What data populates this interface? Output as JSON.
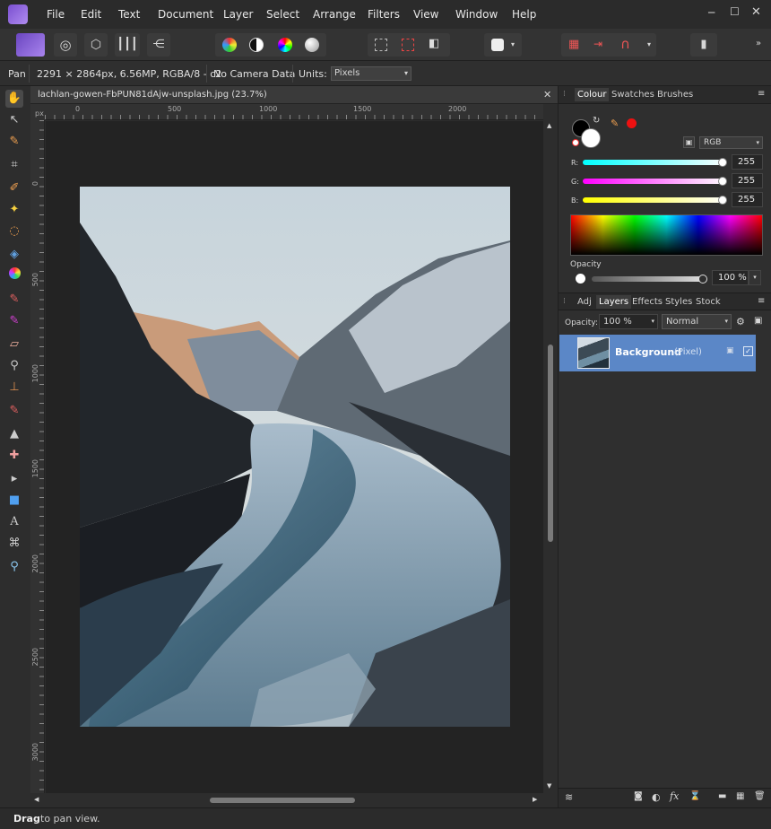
{
  "menu": [
    "File",
    "Edit",
    "Text",
    "Document",
    "Layer",
    "Select",
    "Arrange",
    "Filters",
    "View",
    "Window",
    "Help"
  ],
  "context": {
    "tool": "Pan",
    "info": "2291 × 2864px, 6.56MP, RGBA/8 - c2",
    "camera": "No Camera Data",
    "units_label": "Units:",
    "units_value": "Pixels"
  },
  "document": {
    "tab_title": "lachlan-gowen-FbPUN81dAjw-unsplash.jpg (23.7%)"
  },
  "rulers": {
    "top_unit": "px",
    "top": [
      "0",
      "500",
      "1000",
      "1500",
      "2000"
    ],
    "left": [
      "0",
      "500",
      "1000",
      "1500",
      "2000",
      "2500",
      "3000"
    ]
  },
  "colour_panel": {
    "tabs": [
      "Colour",
      "Swatches",
      "Brushes"
    ],
    "model": "RGB",
    "channels": [
      {
        "label": "R:",
        "value": "255"
      },
      {
        "label": "G:",
        "value": "255"
      },
      {
        "label": "B:",
        "value": "255"
      }
    ],
    "opacity_label": "Opacity",
    "opacity_value": "100 %"
  },
  "layers_panel": {
    "tabs": [
      "Adj",
      "Layers",
      "Effects",
      "Styles",
      "Stock"
    ],
    "opacity_label": "Opacity:",
    "opacity_value": "100 %",
    "blend_mode": "Normal",
    "layers": [
      {
        "name": "Background",
        "type": "(Pixel)"
      }
    ]
  },
  "status": {
    "bold": "Drag",
    "text": " to pan view."
  },
  "colors": {
    "accent": "#5b87c7",
    "affinity_purple": "#8b5fd8"
  }
}
